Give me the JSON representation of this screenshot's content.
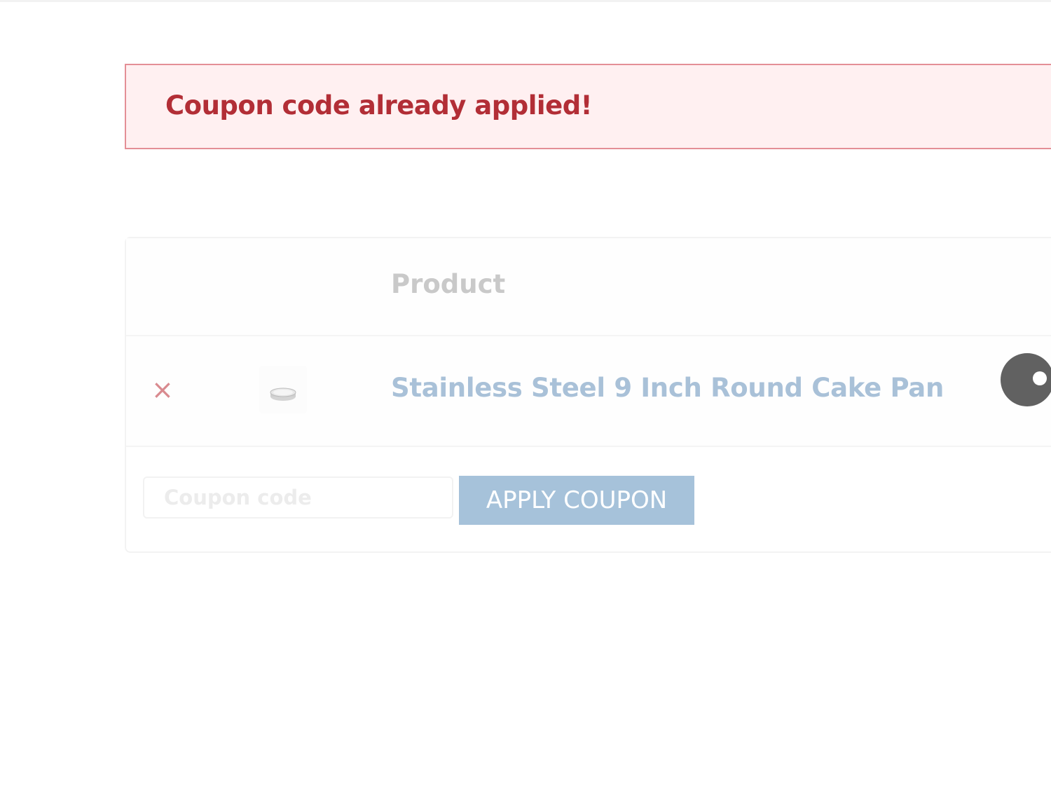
{
  "notice": {
    "message": "Coupon code already applied!",
    "type": "error"
  },
  "cart": {
    "columns": {
      "product": "Product"
    },
    "items": [
      {
        "name": "Stainless Steel 9 Inch Round Cake Pan",
        "remove_icon": "close-icon"
      }
    ],
    "coupon": {
      "placeholder": "Coupon code",
      "value": "",
      "apply_label": "APPLY COUPON"
    }
  },
  "colors": {
    "notice_text": "#b22e36",
    "notice_bg": "#fff0f1",
    "notice_border": "#e48f96",
    "link": "#a9c1d8",
    "button_bg": "#a6c2da",
    "remove": "#d98a8f"
  }
}
